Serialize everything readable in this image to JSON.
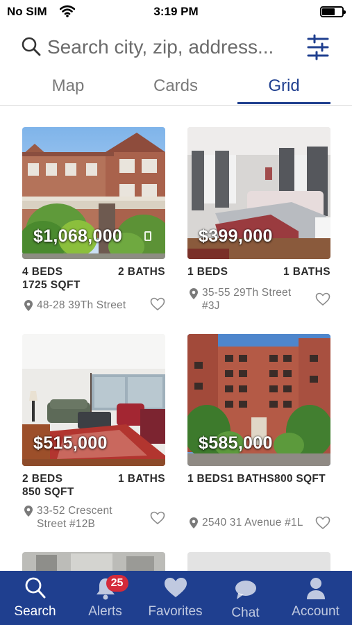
{
  "status_bar": {
    "carrier": "No SIM",
    "time": "3:19 PM"
  },
  "search": {
    "placeholder": "Search city, zip, address..."
  },
  "tabs": [
    {
      "label": "Map",
      "active": false
    },
    {
      "label": "Cards",
      "active": false
    },
    {
      "label": "Grid",
      "active": true
    }
  ],
  "listings": [
    {
      "price": "$1,068,000",
      "beds": "4 BEDS",
      "baths": "2 BATHS",
      "sqft": "1725 SQFT",
      "address": "48-28 39Th Street"
    },
    {
      "price": "$399,000",
      "beds": "1 BEDS",
      "baths": "1 BATHS",
      "address": "35-55 29Th Street #3J"
    },
    {
      "price": "$515,000",
      "beds": "2 BEDS",
      "baths": "1 BATHS",
      "sqft": "850 SQFT",
      "address": "33-52 Crescent Street #12B"
    },
    {
      "price": "$585,000",
      "details": "1 BEDS1 BATHS800 SQFT",
      "address": "2540 31 Avenue #1L"
    }
  ],
  "tabbar": {
    "items": [
      {
        "label": "Search",
        "icon": "search-icon",
        "active": true
      },
      {
        "label": "Alerts",
        "icon": "bell-icon",
        "badge": "25"
      },
      {
        "label": "Favorites",
        "icon": "heart-icon"
      },
      {
        "label": "Chat",
        "icon": "chat-bubble-icon"
      },
      {
        "label": "Account",
        "icon": "person-icon"
      }
    ]
  },
  "colors": {
    "brand": "#1f3f8f",
    "badge": "#d42a3a",
    "active_tab": "#1f3f8f"
  }
}
